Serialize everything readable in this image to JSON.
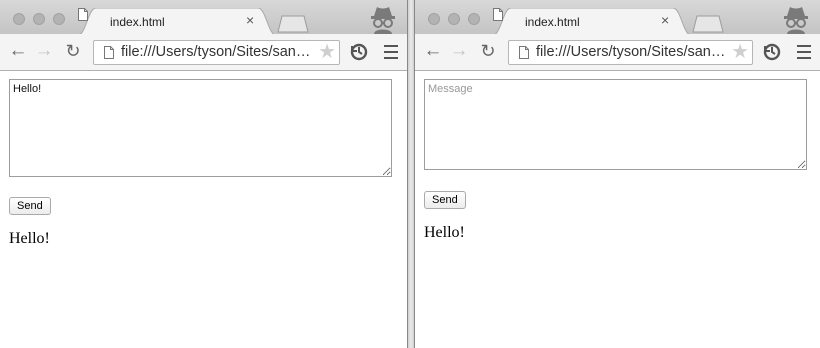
{
  "left": {
    "tab": {
      "title": "index.html",
      "close": "×"
    },
    "address": {
      "url": "file:///Users/tyson/Sites/san…"
    },
    "message_input": {
      "value": "Hello!",
      "placeholder": ""
    },
    "send_label": "Send",
    "messages": [
      "Hello!"
    ]
  },
  "right": {
    "tab": {
      "title": "index.html",
      "close": "×"
    },
    "address": {
      "url": "file:///Users/tyson/Sites/san…"
    },
    "message_input": {
      "value": "",
      "placeholder": "Message"
    },
    "send_label": "Send",
    "messages": [
      "Hello!"
    ]
  },
  "icons": {
    "back": "back-arrow-icon",
    "forward": "forward-arrow-icon",
    "reload": "reload-icon",
    "star": "star-icon",
    "extension": "sync-extension-icon",
    "menu": "hamburger-menu-icon",
    "incognito": "incognito-icon",
    "page": "page-icon"
  },
  "colors": {
    "chrome_frame": "#c9c9c9",
    "toolbar": "#f4f4f4",
    "tab_active": "#f4f4f4"
  }
}
